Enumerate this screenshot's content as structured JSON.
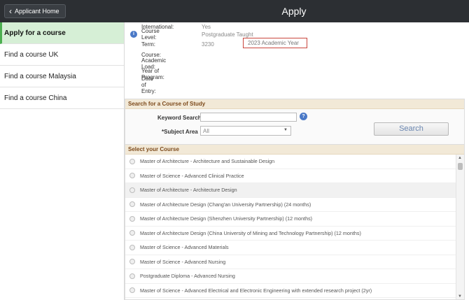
{
  "header": {
    "back_label": "Applicant Home",
    "title": "Apply"
  },
  "sidebar": {
    "items": [
      {
        "label": "Apply for a course"
      },
      {
        "label": "Find a course UK"
      },
      {
        "label": "Find a course Malaysia"
      },
      {
        "label": "Find a course China"
      }
    ]
  },
  "details": {
    "international_label": "International:",
    "international_value": "Yes",
    "level_label": "Course Level:",
    "level_value": "Postgraduate Taught",
    "term_label": "Term:",
    "term_code": "3230",
    "term_value": "2023 Academic Year",
    "course_label": "Course:",
    "load_label": "Academic Load:",
    "year_label": "Year of Program:",
    "entry_label": "Date of Entry:"
  },
  "search": {
    "heading": "Search for a Course of Study",
    "keyword_label": "Keyword Search",
    "keyword_value": "",
    "subject_label": "*Subject Area",
    "subject_value": "All",
    "button_label": "Search"
  },
  "courses": {
    "heading": "Select your Course",
    "items": [
      "Master of Architecture - Architecture and Sustainable Design",
      "Master of Science - Advanced Clinical Practice",
      "Master of Architecture - Architecture Design",
      "Master of Architecture Design (Chang'an University Partnership) (24 months)",
      "Master of Architecture Design (Shenzhen University Partnership) (12 months)",
      "Master of Architecture Design (China University of Mining and Technology Partnership) (12 months)",
      "Master of Science - Advanced Materials",
      "Master of Science - Advanced Nursing",
      "Postgraduate Diploma - Advanced Nursing",
      "Master of Science - Advanced Electrical and Electronic Engineering with extended research project (2yr)"
    ],
    "highlighted_index": 2
  },
  "colors": {
    "topbar": "#2c2f33",
    "active_sidebar": "#d6efd6",
    "panel_heading_text": "#7d4a1b",
    "term_outline": "#c9463d"
  },
  "icons": [
    "chevron-left-icon",
    "info-icon",
    "help-icon",
    "dropdown-arrow-icon",
    "scroll-up-icon",
    "scroll-down-icon"
  ]
}
